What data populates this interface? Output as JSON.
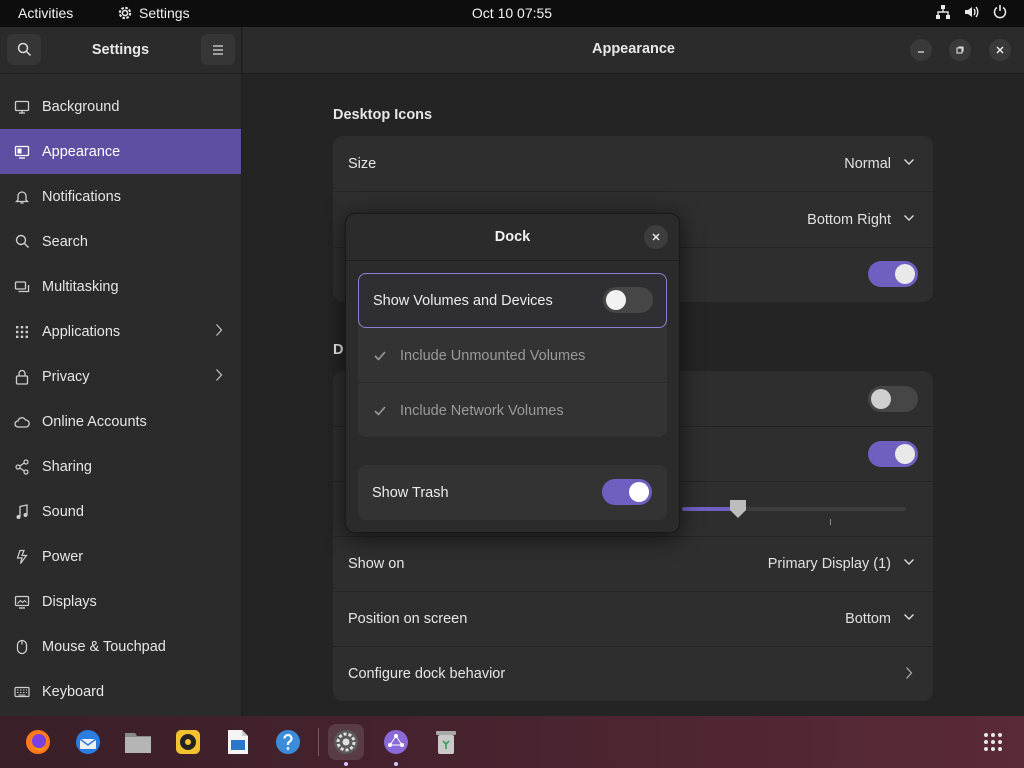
{
  "topbar": {
    "activities": "Activities",
    "app_name": "Settings",
    "clock": "Oct 10  07:55"
  },
  "sidebar": {
    "title": "Settings",
    "items": [
      {
        "label": "Background",
        "icon": "background-icon"
      },
      {
        "label": "Appearance",
        "icon": "appearance-icon",
        "active": true
      },
      {
        "label": "Notifications",
        "icon": "bell-icon"
      },
      {
        "label": "Search",
        "icon": "search-icon"
      },
      {
        "label": "Multitasking",
        "icon": "multitasking-icon"
      },
      {
        "label": "Applications",
        "icon": "grid-icon",
        "chevron": true
      },
      {
        "label": "Privacy",
        "icon": "lock-icon",
        "chevron": true
      },
      {
        "label": "Online Accounts",
        "icon": "cloud-icon"
      },
      {
        "label": "Sharing",
        "icon": "share-icon"
      },
      {
        "label": "Sound",
        "icon": "music-icon"
      },
      {
        "label": "Power",
        "icon": "power-icon"
      },
      {
        "label": "Displays",
        "icon": "display-icon"
      },
      {
        "label": "Mouse & Touchpad",
        "icon": "mouse-icon"
      },
      {
        "label": "Keyboard",
        "icon": "keyboard-icon"
      }
    ]
  },
  "content": {
    "title": "Appearance",
    "desktop_icons": {
      "title": "Desktop Icons",
      "size_label": "Size",
      "size_value": "Normal",
      "position_value": "Bottom Right"
    },
    "dock_section": {
      "title_fragment": "D",
      "show_on_label": "Show on",
      "show_on_value": "Primary Display (1)",
      "position_label": "Position on screen",
      "position_value": "Bottom",
      "configure_label": "Configure dock behavior"
    }
  },
  "dialog": {
    "title": "Dock",
    "show_volumes": {
      "label": "Show Volumes and Devices",
      "enabled": false
    },
    "include_unmounted": {
      "label": "Include Unmounted Volumes",
      "checked": true
    },
    "include_network": {
      "label": "Include Network Volumes",
      "checked": true
    },
    "show_trash": {
      "label": "Show Trash",
      "enabled": true
    }
  },
  "colors": {
    "accent": "#6f5fc0",
    "sidebar_active": "#5e4fa2"
  },
  "dock": {
    "apps": [
      "firefox-icon",
      "thunderbird-icon",
      "files-icon",
      "rhythmbox-icon",
      "libreoffice-writer-icon",
      "help-icon",
      "settings-icon",
      "network-app-icon",
      "trash-icon",
      "app-grid-icon"
    ]
  }
}
